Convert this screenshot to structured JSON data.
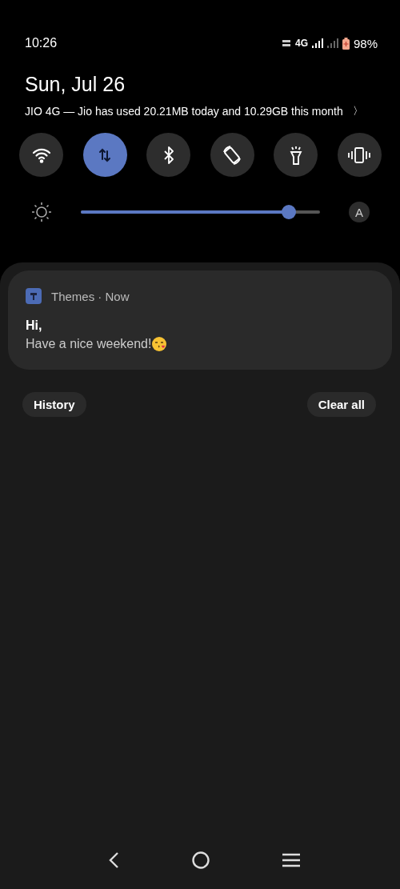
{
  "status_bar": {
    "time": "10:26",
    "network": "4G",
    "battery": "98%"
  },
  "date": "Sun, Jul 26",
  "data_usage": {
    "text": "JIO 4G — Jio has used 20.21MB today and 10.29GB this month",
    "chevron": "〉"
  },
  "tiles": [
    {
      "kind": "wifi",
      "on": false
    },
    {
      "kind": "data",
      "on": true
    },
    {
      "kind": "bluetooth",
      "on": false
    },
    {
      "kind": "rotate",
      "on": false
    },
    {
      "kind": "flashlight",
      "on": false
    },
    {
      "kind": "vibrate",
      "on": false
    }
  ],
  "brightness": {
    "level": 0.87,
    "auto": "A"
  },
  "notifications": [
    {
      "app": "Themes",
      "separator": "·",
      "time": "Now",
      "title": "Hi,",
      "body": "Have a nice weekend!"
    }
  ],
  "buttons": {
    "history": "History",
    "clear": "Clear all"
  }
}
